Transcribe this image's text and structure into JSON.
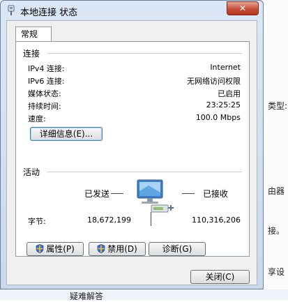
{
  "window": {
    "title": "本地连接 状态",
    "close_label": "✕"
  },
  "background_window": {
    "text_right": [
      "类型:",
      "由器",
      "接。",
      "享设"
    ],
    "text_bottom": "疑难解答"
  },
  "tabs": [
    {
      "label": "常规"
    }
  ],
  "connection": {
    "heading": "连接",
    "rows": [
      {
        "label": "IPv4 连接:",
        "value": "Internet"
      },
      {
        "label": "IPv6 连接:",
        "value": "无网络访问权限"
      },
      {
        "label": "媒体状态:",
        "value": "已启用"
      },
      {
        "label": "持续时间:",
        "value": "23:25:25"
      },
      {
        "label": "速度:",
        "value": "100.0 Mbps"
      }
    ],
    "details_button": "详细信息(E)..."
  },
  "activity": {
    "heading": "活动",
    "sent_label": "已发送",
    "received_label": "已接收",
    "bytes_label": "字节:",
    "bytes_sent": "18,672,199",
    "bytes_received": "110,316,206"
  },
  "buttons": {
    "properties": "属性(P)",
    "disable": "禁用(D)",
    "diagnose": "诊断(G)",
    "close": "关闭(C)"
  },
  "colors": {
    "accent": "#3c7fb1",
    "close_button": "#c7503a"
  }
}
